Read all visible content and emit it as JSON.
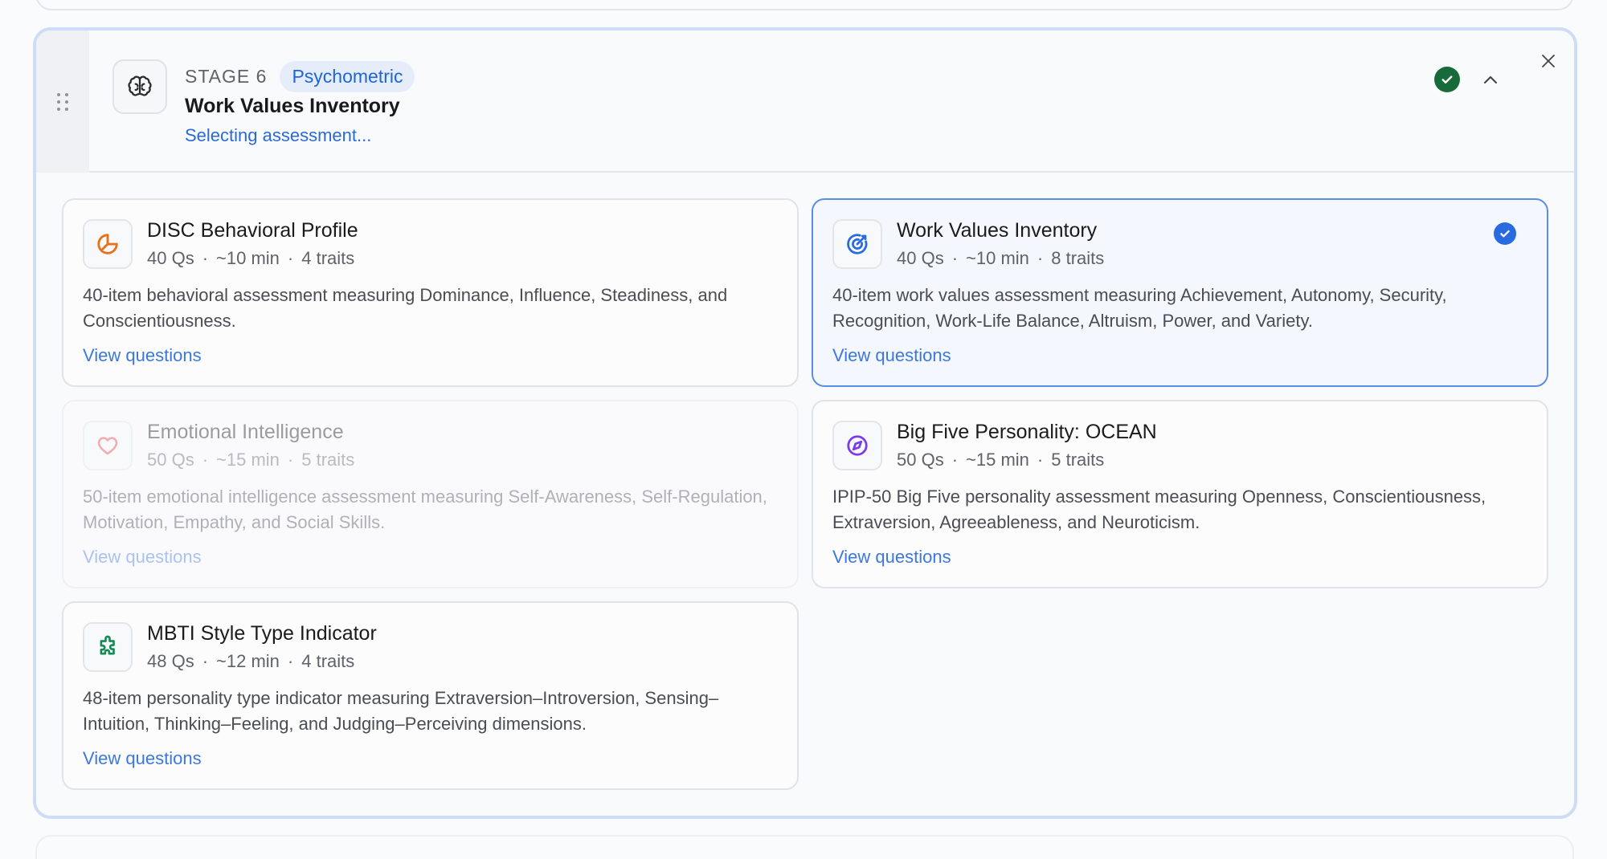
{
  "stage": {
    "label": "STAGE 6",
    "badge": "Psychometric",
    "title": "Work Values Inventory",
    "status": "Selecting assessment..."
  },
  "colors": {
    "accent": "#2a6ad6",
    "complete_check": "#176b3a",
    "selected_border": "#5a8de6"
  },
  "assessments": [
    {
      "title": "DISC Behavioral Profile",
      "qs": "40 Qs",
      "time": "~10 min",
      "traits": "4 traits",
      "description": "40-item behavioral assessment measuring Dominance, Influence, Steadiness, and Conscientiousness.",
      "link": "View questions",
      "icon": "pie-chart-icon",
      "icon_color": "#e8711c",
      "state": "default"
    },
    {
      "title": "Work Values Inventory",
      "qs": "40 Qs",
      "time": "~10 min",
      "traits": "8 traits",
      "description": "40-item work values assessment measuring Achievement, Autonomy, Security, Recognition, Work-Life Balance, Altruism, Power, and Variety.",
      "link": "View questions",
      "icon": "target-icon",
      "icon_color": "#2a6ae0",
      "state": "selected"
    },
    {
      "title": "Emotional Intelligence",
      "qs": "50 Qs",
      "time": "~15 min",
      "traits": "5 traits",
      "description": "50-item emotional intelligence assessment measuring Self-Awareness, Self-Regulation, Motivation, Empathy, and Social Skills.",
      "link": "View questions",
      "icon": "heart-icon",
      "icon_color": "#e5484d",
      "state": "disabled"
    },
    {
      "title": "Big Five Personality: OCEAN",
      "qs": "50 Qs",
      "time": "~15 min",
      "traits": "5 traits",
      "description": "IPIP-50 Big Five personality assessment measuring Openness, Conscientiousness, Extraversion, Agreeableness, and Neuroticism.",
      "link": "View questions",
      "icon": "compass-icon",
      "icon_color": "#7c3aed",
      "state": "default"
    },
    {
      "title": "MBTI Style Type Indicator",
      "qs": "48 Qs",
      "time": "~12 min",
      "traits": "4 traits",
      "description": "48-item personality type indicator measuring Extraversion–Introversion, Sensing–Intuition, Thinking–Feeling, and Judging–Perceiving dimensions.",
      "link": "View questions",
      "icon": "puzzle-icon",
      "icon_color": "#168a55",
      "state": "default"
    }
  ]
}
